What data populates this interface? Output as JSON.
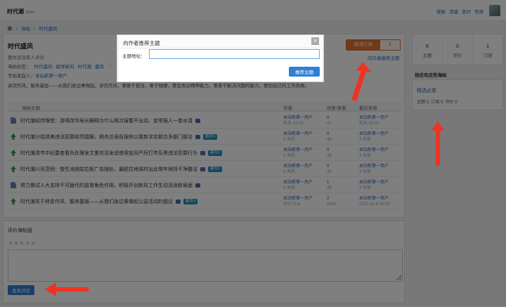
{
  "header": {
    "logo": "时代潮",
    "beta": "beta",
    "nav": [
      "搜索",
      "求援",
      "添问",
      "常用"
    ]
  },
  "breadcrumb": [
    "海帖",
    "时代盛风"
  ],
  "group": {
    "title": "时代盛风",
    "subtitle": "暂时还没有人评分",
    "tags_label": "海帖标签：",
    "tags": [
      "时代盛风",
      "倡导新风",
      "时代潮",
      "盛风",
      "…"
    ],
    "owner_label": "专帖发起人：",
    "owner": "本站新第一用户",
    "description": "讲究作风，服务基层——从我们身边事做起。讲究作风，要敢于担当，敢于碰硬，要会表达精神能力。要善于解决问题的能力，要回自己的工作风格。",
    "subscribe_label": "取消订阅",
    "subscribe_count": "1",
    "recommend_link": "向作者推荐主题"
  },
  "table": {
    "headers": {
      "topic": "海帖主题",
      "author": "作者",
      "replies": "回复/查看",
      "last": "最后发表"
    },
    "rows": [
      {
        "icon": "doc",
        "title": "时代潮经持理想：游得改华局长解释为什么两次报警不出动、宣举报人一查水清",
        "image": true,
        "badge": "",
        "author": "本站新第一用户",
        "author_time": "前天 23:02",
        "replies": "0",
        "views": "41",
        "last_user": "本站新第一用户",
        "last_time": "前天 23:02"
      },
      {
        "icon": "up",
        "title": "时代潮沙绕清美违法犯罪依然猖獗，税务总局告报附以重新求实联合多部门部治",
        "image": true,
        "badge": "精华3",
        "author": "本站新第一用户",
        "author_time": "3 天前",
        "replies": "0",
        "views": "48",
        "last_user": "本站新第一用户",
        "last_time": "3 天前"
      },
      {
        "icon": "up",
        "title": "时代潮清市中纪委查看负处理发文重信法发说使用宣风严厉打市反黑违法犯罪行为",
        "image": true,
        "badge": "精华1",
        "author": "本站新第一用户",
        "author_time": "3 天前",
        "replies": "0",
        "views": "38",
        "last_user": "本站新第一用户",
        "last_time": "3 天前"
      },
      {
        "icon": "up",
        "title": "时代潮川风范例：營生池姚姑拉板广告随处，最航拉地球村出此常年保持干净整洁",
        "image": true,
        "badge": "精华2",
        "author": "本站新第一用户",
        "author_time": "3 天前",
        "replies": "0",
        "views": "33",
        "last_user": "本站新第一用户",
        "last_time": "3 天前"
      },
      {
        "icon": "doc",
        "title": "努力做试人大支持不可替代的监督角色作用，积极开创新风工作生动活泼新局面",
        "image": true,
        "badge": "",
        "author": "本站新第一用户",
        "author_time": "5 天前",
        "replies": "1",
        "views": "38",
        "last_user": "本站新第一用户",
        "last_time": "3 天前"
      },
      {
        "icon": "up",
        "title": "时代潮关于转变作风、服务基层——从我们身边事做起公益活动的倡议",
        "image": true,
        "badge": "精华3",
        "author": "本站新第一用户",
        "author_time": "2017-5-8",
        "replies": "2",
        "views": "8342",
        "last_user": "本站新第一用户",
        "last_time": "2022-11-8 23:19"
      }
    ]
  },
  "comment": {
    "title": "评价海帖组",
    "stars": "★★★★★",
    "submit": "发表评论"
  },
  "sidebar": {
    "stats": [
      {
        "value": "6",
        "label": "主题"
      },
      {
        "value": "0",
        "label": "评价"
      },
      {
        "value": "1",
        "label": "订阅"
      }
    ],
    "related_title": "他还有这些海帖",
    "related": {
      "name": "精选必看",
      "meta": "主题 0, 订阅 0, 评价 0"
    }
  },
  "modal": {
    "title": "向作者推荐主题",
    "field_label": "主题地址：",
    "field_value": "",
    "submit": "推荐主题"
  },
  "colors": {
    "accent": "#2f7fd6",
    "subscribe": "#e8702a",
    "arrow": "#ee3322"
  }
}
